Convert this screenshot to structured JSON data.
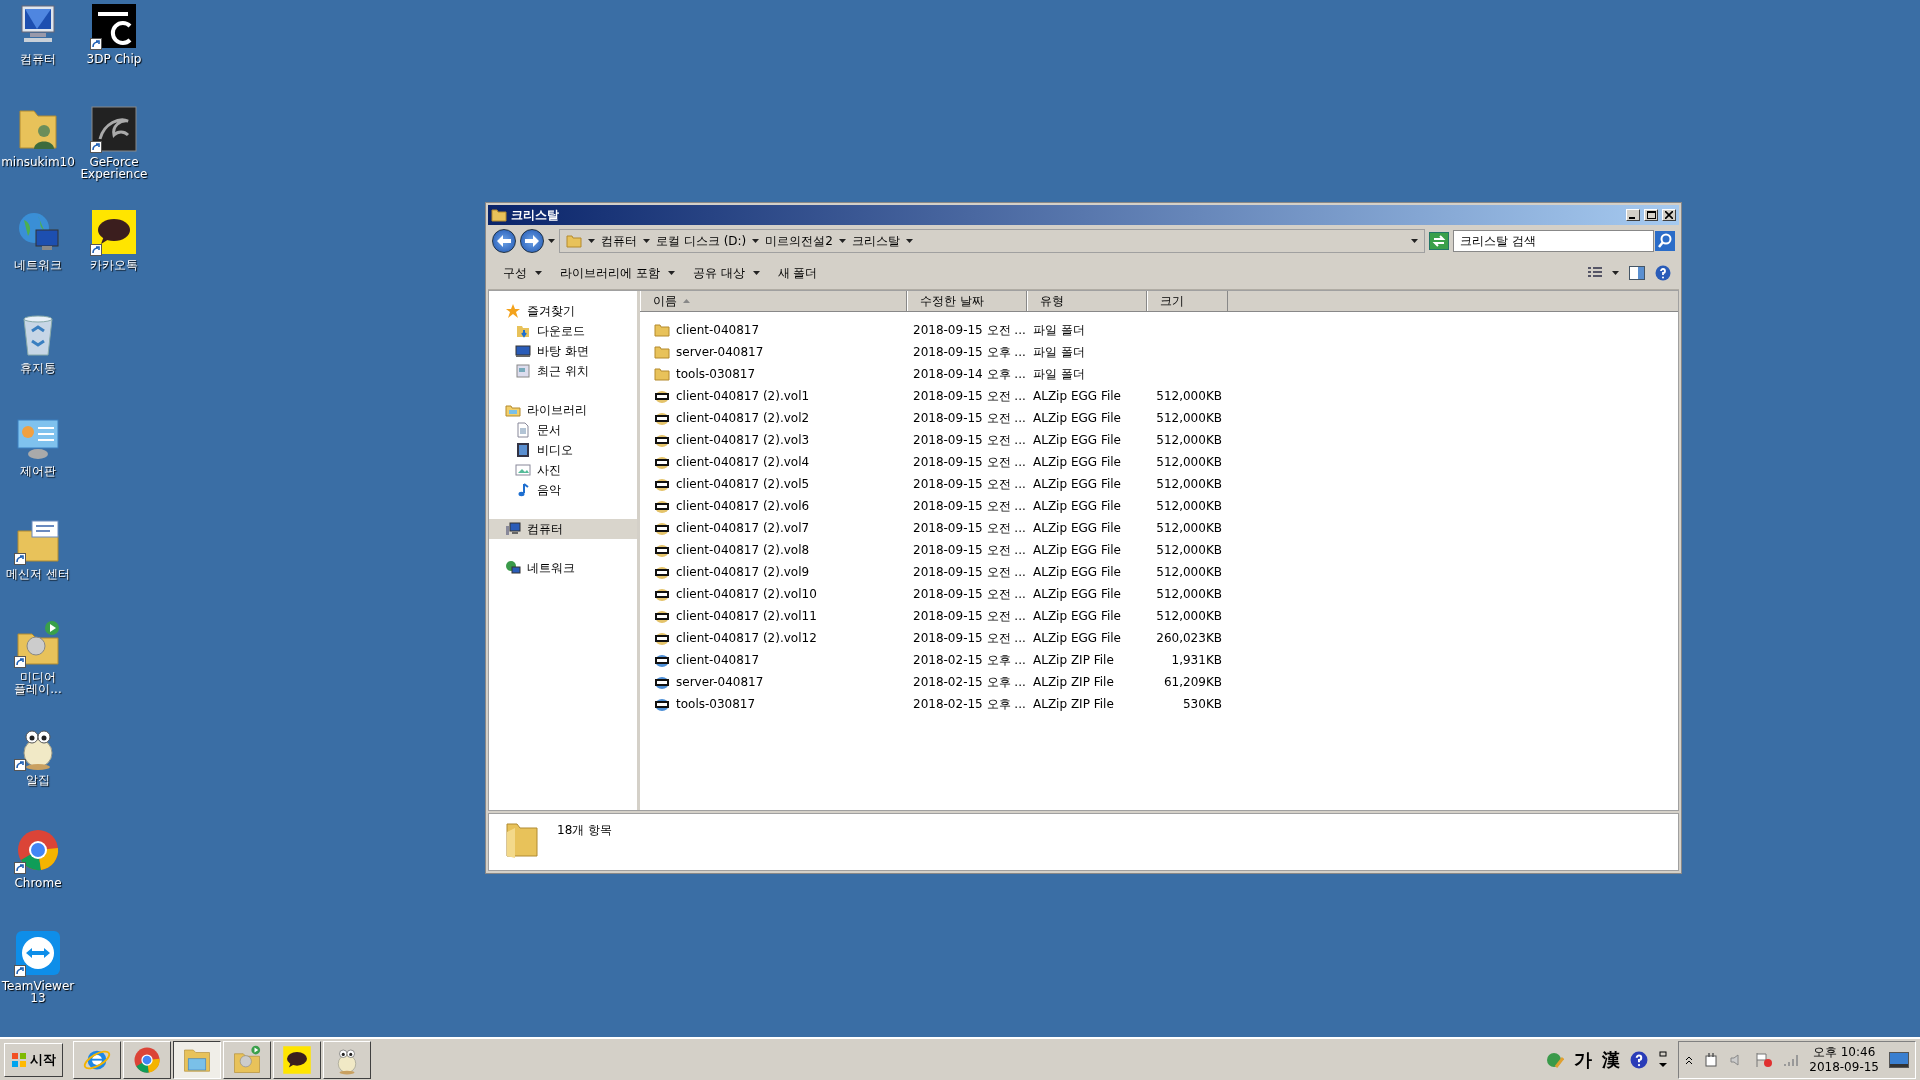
{
  "desktop_icons": [
    {
      "label": "컴퓨터",
      "kind": "computer",
      "shortcut": false
    },
    {
      "label": "minsukim10",
      "kind": "userfolder",
      "shortcut": false
    },
    {
      "label": "네트워크",
      "kind": "network",
      "shortcut": false
    },
    {
      "label": "휴지통",
      "kind": "recycle",
      "shortcut": false
    },
    {
      "label": "제어판",
      "kind": "control",
      "shortcut": false
    },
    {
      "label": "메신저 센터",
      "kind": "messenger",
      "shortcut": true
    },
    {
      "label": "미디어 플레이...",
      "kind": "media",
      "shortcut": true
    },
    {
      "label": "알집",
      "kind": "mascot",
      "shortcut": true
    },
    {
      "label": "Chrome",
      "kind": "chrome",
      "shortcut": true
    },
    {
      "label": "TeamViewer 13",
      "kind": "teamviewer",
      "shortcut": true
    },
    {
      "label": "3DP Chip",
      "kind": "chip",
      "shortcut": true
    },
    {
      "label": "GeForce Experience",
      "kind": "geforce",
      "shortcut": true
    },
    {
      "label": "카카오톡",
      "kind": "talk",
      "shortcut": true
    }
  ],
  "window": {
    "title": "크리스탈",
    "address": [
      "컴퓨터",
      "로컬 디스크 (D:)",
      "미르의전설2",
      "크리스탈"
    ],
    "search": {
      "placeholder": "크리스탈 검색"
    },
    "toolbar": [
      {
        "label": "구성",
        "dropdown": true
      },
      {
        "label": "라이브러리에 포함",
        "dropdown": true
      },
      {
        "label": "공유 대상",
        "dropdown": true
      },
      {
        "label": "새 폴더",
        "dropdown": false
      }
    ],
    "nav": [
      {
        "label": "즐겨찾기",
        "kind": "star",
        "selected": false,
        "children": [
          {
            "label": "다운로드",
            "kind": "download",
            "selected": false
          },
          {
            "label": "바탕 화면",
            "kind": "desktop",
            "selected": false
          },
          {
            "label": "최근 위치",
            "kind": "recent",
            "selected": false
          }
        ]
      },
      {
        "label": "라이브러리",
        "kind": "library",
        "selected": false,
        "children": [
          {
            "label": "문서",
            "kind": "document",
            "selected": false
          },
          {
            "label": "비디오",
            "kind": "video",
            "selected": false
          },
          {
            "label": "사진",
            "kind": "picture",
            "selected": false
          },
          {
            "label": "음악",
            "kind": "music",
            "selected": false
          }
        ]
      },
      {
        "label": "컴퓨터",
        "kind": "computer",
        "selected": true
      },
      {
        "label": "네트워크",
        "kind": "network",
        "selected": false
      }
    ],
    "columns": [
      {
        "label": "이름",
        "sorted": true
      },
      {
        "label": "수정한 날짜",
        "sorted": false
      },
      {
        "label": "유형",
        "sorted": false
      },
      {
        "label": "크기",
        "sorted": false
      }
    ],
    "files": [
      {
        "kind": "folder",
        "name": "client-040817",
        "date": "2018-09-15 오전 ...",
        "type": "파일 폴더"
      },
      {
        "kind": "folder",
        "name": "server-040817",
        "date": "2018-09-15 오후 ...",
        "type": "파일 폴더"
      },
      {
        "kind": "folder",
        "name": "tools-030817",
        "date": "2018-09-14 오후 ...",
        "type": "파일 폴더"
      },
      {
        "kind": "egg",
        "name": "client-040817 (2).vol1",
        "date": "2018-09-15 오전 ...",
        "type": "ALZip EGG File",
        "size": "512,000KB"
      },
      {
        "kind": "egg",
        "name": "client-040817 (2).vol2",
        "date": "2018-09-15 오전 ...",
        "type": "ALZip EGG File",
        "size": "512,000KB"
      },
      {
        "kind": "egg",
        "name": "client-040817 (2).vol3",
        "date": "2018-09-15 오전 ...",
        "type": "ALZip EGG File",
        "size": "512,000KB"
      },
      {
        "kind": "egg",
        "name": "client-040817 (2).vol4",
        "date": "2018-09-15 오전 ...",
        "type": "ALZip EGG File",
        "size": "512,000KB"
      },
      {
        "kind": "egg",
        "name": "client-040817 (2).vol5",
        "date": "2018-09-15 오전 ...",
        "type": "ALZip EGG File",
        "size": "512,000KB"
      },
      {
        "kind": "egg",
        "name": "client-040817 (2).vol6",
        "date": "2018-09-15 오전 ...",
        "type": "ALZip EGG File",
        "size": "512,000KB"
      },
      {
        "kind": "egg",
        "name": "client-040817 (2).vol7",
        "date": "2018-09-15 오전 ...",
        "type": "ALZip EGG File",
        "size": "512,000KB"
      },
      {
        "kind": "egg",
        "name": "client-040817 (2).vol8",
        "date": "2018-09-15 오전 ...",
        "type": "ALZip EGG File",
        "size": "512,000KB"
      },
      {
        "kind": "egg",
        "name": "client-040817 (2).vol9",
        "date": "2018-09-15 오전 ...",
        "type": "ALZip EGG File",
        "size": "512,000KB"
      },
      {
        "kind": "egg",
        "name": "client-040817 (2).vol10",
        "date": "2018-09-15 오전 ...",
        "type": "ALZip EGG File",
        "size": "512,000KB"
      },
      {
        "kind": "egg",
        "name": "client-040817 (2).vol11",
        "date": "2018-09-15 오전 ...",
        "type": "ALZip EGG File",
        "size": "512,000KB"
      },
      {
        "kind": "egg",
        "name": "client-040817 (2).vol12",
        "date": "2018-09-15 오전 ...",
        "type": "ALZip EGG File",
        "size": "260,023KB"
      },
      {
        "kind": "zip",
        "name": "client-040817",
        "date": "2018-02-15 오후 ...",
        "type": "ALZip ZIP File",
        "size": "1,931KB"
      },
      {
        "kind": "zip",
        "name": "server-040817",
        "date": "2018-02-15 오후 ...",
        "type": "ALZip ZIP File",
        "size": "61,209KB"
      },
      {
        "kind": "zip",
        "name": "tools-030817",
        "date": "2018-02-15 오후 ...",
        "type": "ALZip ZIP File",
        "size": "530KB"
      }
    ],
    "status": "18개 항목"
  },
  "taskbar": {
    "start": "시작",
    "buttons": [
      {
        "kind": "ie",
        "selected": false
      },
      {
        "kind": "chrome",
        "selected": false
      },
      {
        "kind": "explorer",
        "selected": true
      },
      {
        "kind": "media",
        "selected": false
      },
      {
        "kind": "talk",
        "selected": false
      },
      {
        "kind": "mascot",
        "selected": false
      }
    ],
    "ime": [
      "가",
      "漢"
    ],
    "clock": {
      "time": "오후 10:46",
      "date": "2018-09-15"
    }
  }
}
